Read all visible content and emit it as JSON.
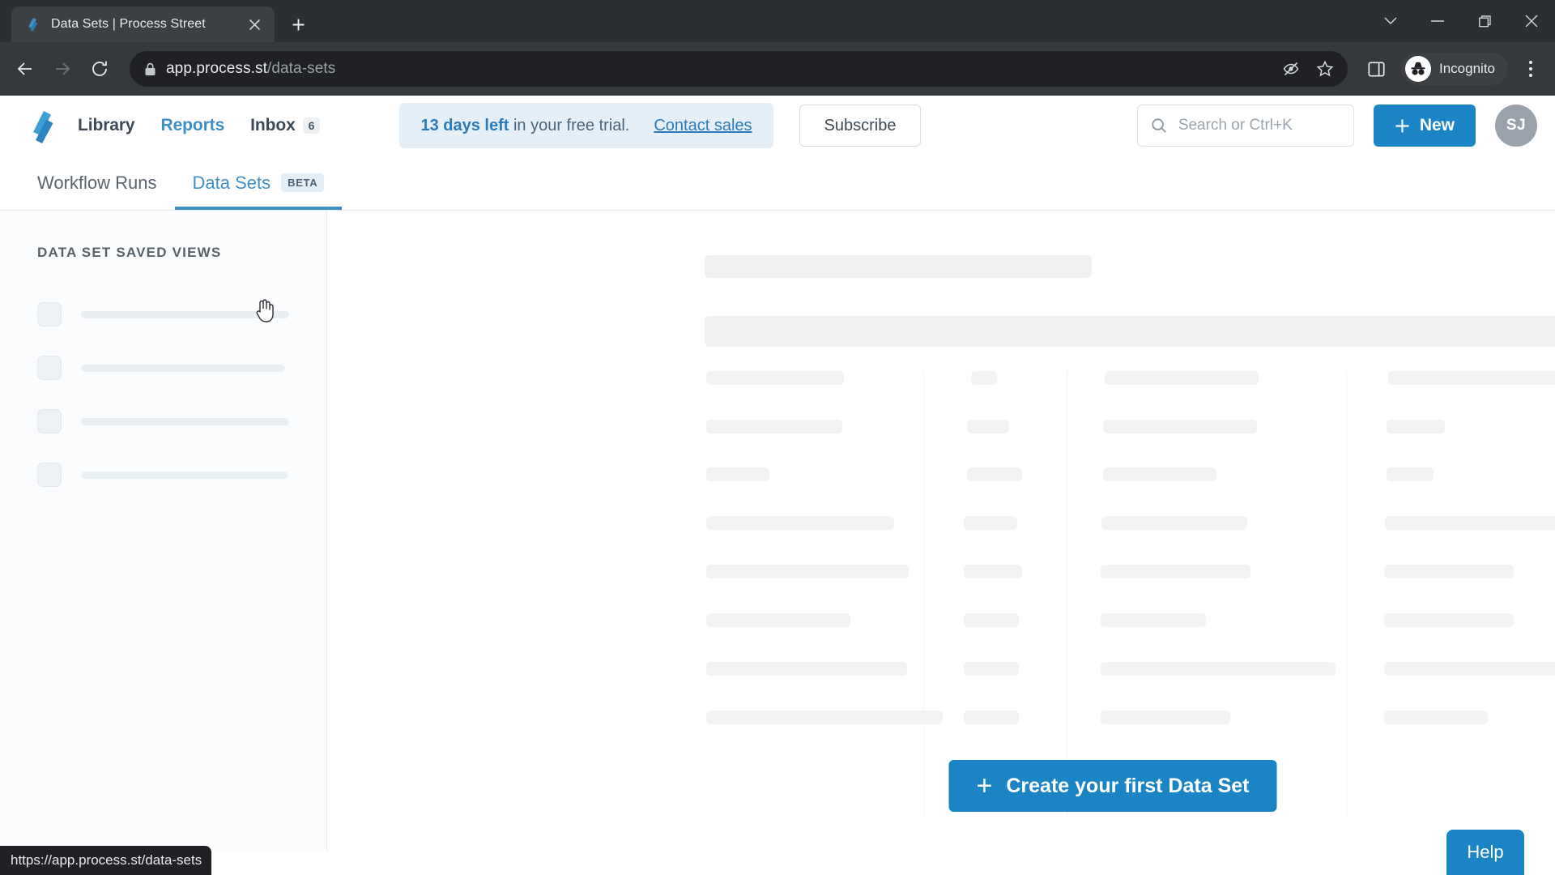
{
  "browser": {
    "tab": {
      "title": "Data Sets | Process Street",
      "favicon_icon": "process-street-logo-icon",
      "close_icon": "close-icon"
    },
    "new_tab_icon": "plus-icon",
    "window_controls": [
      {
        "name": "tab-search",
        "icon": "chevron-down-icon"
      },
      {
        "name": "minimize",
        "icon": "minimize-icon"
      },
      {
        "name": "maximize",
        "icon": "restore-icon"
      },
      {
        "name": "close",
        "icon": "close-icon"
      }
    ],
    "nav": {
      "back_icon": "back-arrow-icon",
      "forward_icon": "forward-arrow-icon",
      "reload_icon": "reload-icon"
    },
    "omnibox": {
      "lock_icon": "lock-icon",
      "url_host": "app.process.st",
      "url_path": "/data-sets",
      "third_party_cookie_icon": "eye-slash-icon",
      "bookmark_icon": "star-icon"
    },
    "side_panel_icon": "side-panel-icon",
    "profile": {
      "label": "Incognito",
      "icon": "incognito-icon"
    },
    "menu_icon": "kebab-menu-icon"
  },
  "app": {
    "logo_icon": "process-street-logo-icon",
    "nav": [
      {
        "label": "Library",
        "accent": false
      },
      {
        "label": "Reports",
        "accent": true
      },
      {
        "label": "Inbox",
        "accent": false,
        "badge": "6"
      }
    ],
    "trial": {
      "highlight": "13 days left",
      "rest": " in your free trial.",
      "link": "Contact sales"
    },
    "subscribe_label": "Subscribe",
    "search": {
      "placeholder": "Search or Ctrl+K",
      "icon": "search-icon"
    },
    "new_button": {
      "label": "New",
      "icon": "plus-icon"
    },
    "avatar_initials": "SJ",
    "workspace_tabs": [
      {
        "label": "Workflow Runs",
        "active": false,
        "badge": null
      },
      {
        "label": "Data Sets",
        "active": true,
        "badge": "BETA"
      }
    ],
    "sidebar": {
      "title": "DATA SET SAVED VIEWS",
      "skeleton_rows": 4
    },
    "main": {
      "create_button": {
        "label": "Create your first Data Set",
        "icon": "plus-icon"
      },
      "loading_skeleton": true
    },
    "help_button": "Help"
  },
  "status_bar": {
    "url": "https://app.process.st/data-sets"
  },
  "colors": {
    "accent_blue": "#1b84c4",
    "nav_accent": "#3f8fc4",
    "banner_bg": "#e4eff7",
    "skeleton": "#eff1f3",
    "browser_chrome": "#35383d",
    "tabstrip": "#2b2e33"
  }
}
